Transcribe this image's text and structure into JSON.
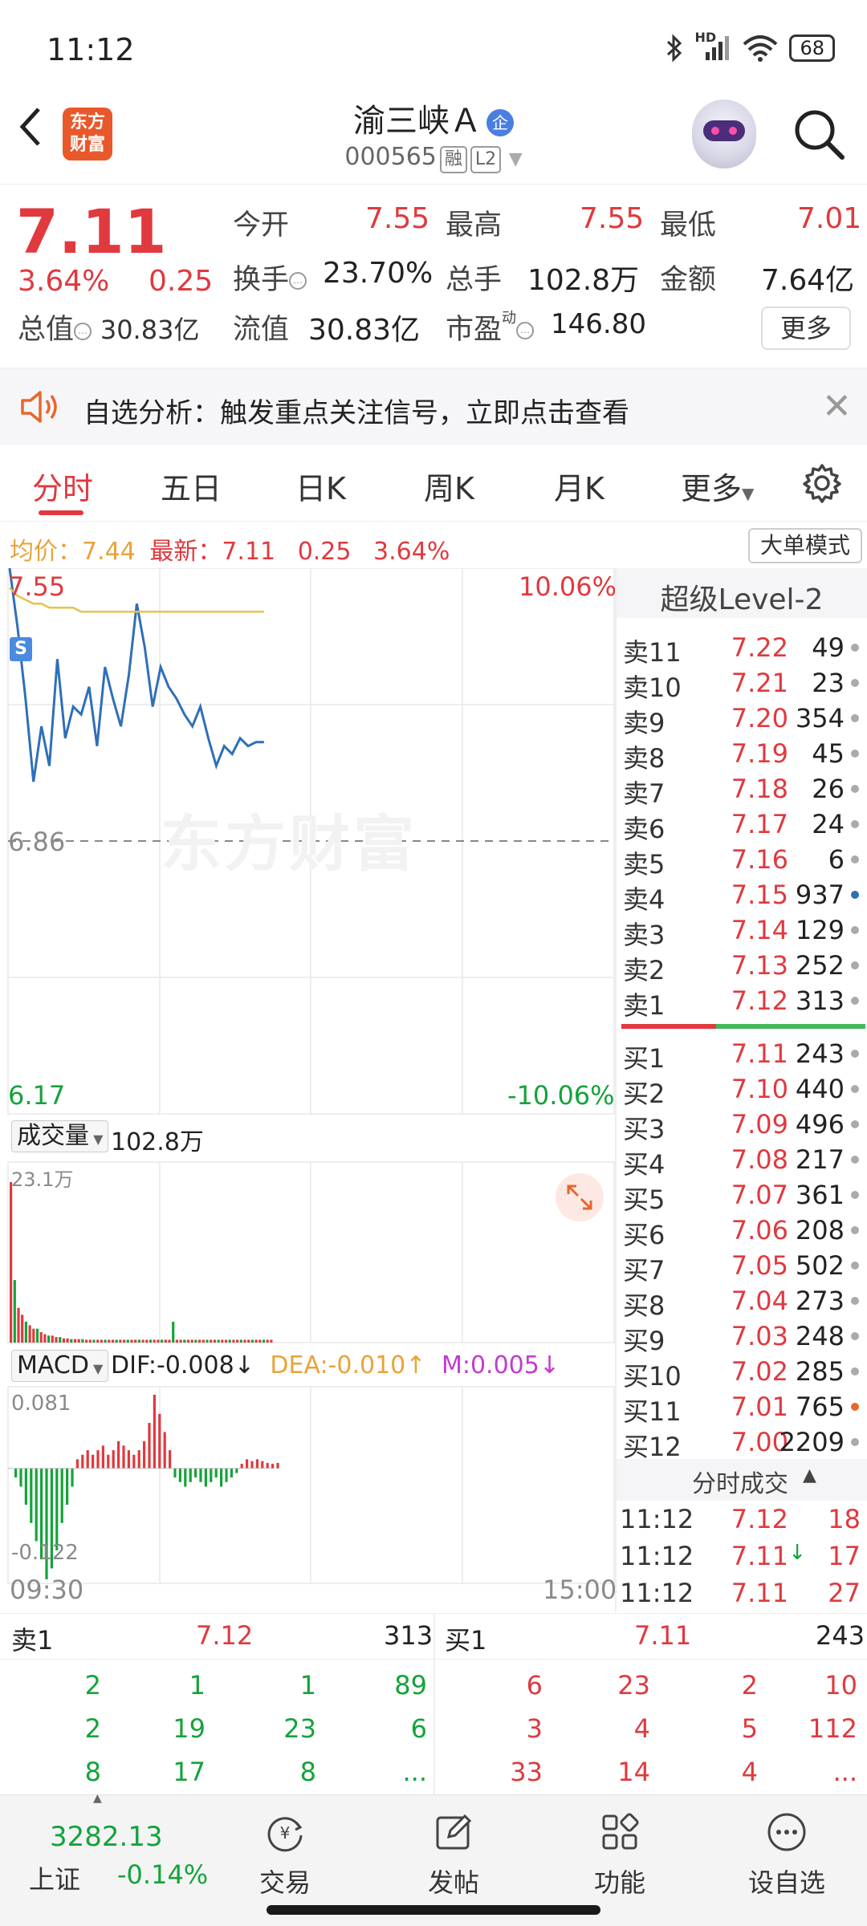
{
  "status_bar": {
    "time": "11:12",
    "hd": "HD",
    "battery": "68"
  },
  "header": {
    "logo_line1": "东方",
    "logo_line2": "财富",
    "stock_name": "渝三峡Ａ",
    "qi_badge": "企",
    "stock_code": "000565",
    "tag_rong": "融",
    "tag_l2": "L2"
  },
  "quote": {
    "last_price": "7.11",
    "change_pct": "3.64%",
    "change_amt": "0.25",
    "open_label": "今开",
    "open": "7.55",
    "high_label": "最高",
    "high": "7.55",
    "low_label": "最低",
    "low": "7.01",
    "turnover_label": "换手",
    "turnover": "23.70%",
    "volume_label": "总手",
    "volume": "102.8万",
    "amount_label": "金额",
    "amount": "7.64亿",
    "total_cap_label": "总值",
    "total_cap": "30.83亿",
    "float_cap_label": "流值",
    "float_cap": "30.83亿",
    "pe_label": "市盈",
    "pe_sup": "动",
    "pe": "146.80",
    "more_label": "更多"
  },
  "notice": {
    "text": "自选分析：触发重点关注信号，立即点击查看"
  },
  "tabs": [
    {
      "label": "分时"
    },
    {
      "label": "五日"
    },
    {
      "label": "日K"
    },
    {
      "label": "周K"
    },
    {
      "label": "月K"
    },
    {
      "label": "更多"
    }
  ],
  "avg_line": {
    "avg_label": "均价：",
    "avg_value": "7.44",
    "latest_label": "最新：",
    "latest": "7.11",
    "chg": "0.25",
    "pct": "3.64%",
    "big_order_label": "大单模式"
  },
  "chart_labels": {
    "top_price": "7.55",
    "top_pct": "10.06%",
    "mid_price": "6.86",
    "bottom_price": "6.17",
    "bottom_pct": "-10.06%",
    "s_marker": "S",
    "watermark": "东方财富",
    "vol_dropdown": "成交量",
    "vol_total": "102.8万",
    "vol_max": "23.1万",
    "macd_dropdown": "MACD",
    "dif": "DIF:-0.008",
    "dif_arrow": "↓",
    "dea": "DEA:-0.010",
    "dea_arrow": "↑",
    "m": "M:0.005",
    "m_arrow": "↓",
    "macd_max": "0.081",
    "macd_min": "-0.122",
    "time_start": "09:30",
    "time_end": "15:00"
  },
  "chart_data": [
    {
      "type": "line",
      "title": "",
      "y_range": [
        6.17,
        7.55
      ],
      "series": [
        {
          "name": "",
          "color": "#2f6fb8",
          "values": [
            7.55,
            7.4,
            7.22,
            7.01,
            7.15,
            7.05,
            7.32,
            7.12,
            7.2,
            7.18,
            7.25,
            7.1,
            7.3,
            7.22,
            7.15,
            7.28,
            7.46,
            7.35,
            7.2,
            7.3,
            7.25,
            7.22,
            7.18,
            7.15,
            7.2,
            7.12,
            7.05,
            7.1,
            7.08,
            7.12,
            7.1,
            7.11,
            7.11
          ]
        },
        {
          "name": "",
          "color": "#e8c24a",
          "values": [
            7.5,
            7.48,
            7.47,
            7.46,
            7.46,
            7.45,
            7.45,
            7.45,
            7.45,
            7.44,
            7.44,
            7.44,
            7.44,
            7.44,
            7.44,
            7.44,
            7.44,
            7.44,
            7.44,
            7.44,
            7.44,
            7.44,
            7.44,
            7.44,
            7.44,
            7.44,
            7.44,
            7.44,
            7.44,
            7.44,
            7.44,
            7.44,
            7.44
          ]
        }
      ]
    },
    {
      "type": "bar",
      "title": "",
      "y_range": [
        0,
        23.1
      ],
      "values": [
        23.1,
        9,
        5,
        4,
        3,
        2.5,
        2,
        2,
        1.5,
        1.2,
        1,
        1,
        0.8,
        0.8,
        0.6,
        0.6,
        0.5,
        0.5,
        0.5,
        0.5,
        0.4,
        0.4,
        0.4,
        0.4,
        0.4,
        0.4,
        0.4,
        0.4,
        0.4,
        0.4,
        0.4,
        0.4,
        0.4,
        0.4,
        0.4,
        0.4,
        0.4,
        0.4,
        0.4,
        0.4,
        0.4,
        0.4,
        0.4,
        3,
        0.4,
        0.4,
        0.4,
        0.4,
        0.4,
        0.4,
        0.4,
        0.4,
        0.4,
        0.4,
        0.4,
        0.4,
        0.4,
        0.4,
        0.4,
        0.4,
        0.4,
        0.4,
        0.4,
        0.4,
        0.4,
        0.4,
        0.4,
        0.4,
        0.4,
        0.4
      ]
    },
    {
      "type": "bar",
      "title": "",
      "y_range": [
        -0.122,
        0.081
      ],
      "values": [
        -0.01,
        -0.02,
        -0.04,
        -0.06,
        -0.08,
        -0.1,
        -0.122,
        -0.11,
        -0.09,
        -0.06,
        -0.04,
        -0.02,
        0.01,
        0.015,
        0.02,
        0.015,
        0.02,
        0.025,
        0.015,
        0.02,
        0.03,
        0.025,
        0.02,
        0.015,
        0.02,
        0.03,
        0.05,
        0.081,
        0.06,
        0.04,
        0.02,
        -0.01,
        -0.015,
        -0.02,
        -0.015,
        -0.01,
        -0.015,
        -0.02,
        -0.015,
        -0.01,
        -0.02,
        -0.015,
        -0.01,
        -0.005,
        0.005,
        0.01,
        0.008,
        0.01,
        0.008,
        0.006,
        0.005,
        0.006
      ]
    }
  ],
  "orderbook": {
    "title": "超级Level-2",
    "asks": [
      {
        "side": "卖11",
        "price": "7.22",
        "vol": "49",
        "dot": "#aaa"
      },
      {
        "side": "卖10",
        "price": "7.21",
        "vol": "23",
        "dot": "#aaa"
      },
      {
        "side": "卖9",
        "price": "7.20",
        "vol": "354",
        "dot": "#aaa"
      },
      {
        "side": "卖8",
        "price": "7.19",
        "vol": "45",
        "dot": "#aaa"
      },
      {
        "side": "卖7",
        "price": "7.18",
        "vol": "26",
        "dot": "#aaa"
      },
      {
        "side": "卖6",
        "price": "7.17",
        "vol": "24",
        "dot": "#aaa"
      },
      {
        "side": "卖5",
        "price": "7.16",
        "vol": "6",
        "dot": "#aaa"
      },
      {
        "side": "卖4",
        "price": "7.15",
        "vol": "937",
        "dot": "#2f6fb8"
      },
      {
        "side": "卖3",
        "price": "7.14",
        "vol": "129",
        "dot": "#aaa"
      },
      {
        "side": "卖2",
        "price": "7.13",
        "vol": "252",
        "dot": "#aaa"
      },
      {
        "side": "卖1",
        "price": "7.12",
        "vol": "313",
        "dot": "#aaa"
      }
    ],
    "bids": [
      {
        "side": "买1",
        "price": "7.11",
        "vol": "243",
        "dot": "#aaa"
      },
      {
        "side": "买2",
        "price": "7.10",
        "vol": "440",
        "dot": "#aaa"
      },
      {
        "side": "买3",
        "price": "7.09",
        "vol": "496",
        "dot": "#aaa"
      },
      {
        "side": "买4",
        "price": "7.08",
        "vol": "217",
        "dot": "#aaa"
      },
      {
        "side": "买5",
        "price": "7.07",
        "vol": "361",
        "dot": "#aaa"
      },
      {
        "side": "买6",
        "price": "7.06",
        "vol": "208",
        "dot": "#aaa"
      },
      {
        "side": "买7",
        "price": "7.05",
        "vol": "502",
        "dot": "#aaa"
      },
      {
        "side": "买8",
        "price": "7.04",
        "vol": "273",
        "dot": "#aaa"
      },
      {
        "side": "买9",
        "price": "7.03",
        "vol": "248",
        "dot": "#aaa"
      },
      {
        "side": "买10",
        "price": "7.02",
        "vol": "285",
        "dot": "#aaa"
      },
      {
        "side": "买11",
        "price": "7.01",
        "vol": "765",
        "dot": "#e8662a"
      },
      {
        "side": "买12",
        "price": "7.00",
        "vol": "2209",
        "dot": "#aaa"
      }
    ],
    "ticks_title": "分时成交",
    "ticks": [
      {
        "time": "11:12",
        "price": "7.12",
        "arrow": "",
        "vol": "18"
      },
      {
        "time": "11:12",
        "price": "7.11",
        "arrow": "↓",
        "vol": "17"
      },
      {
        "time": "11:12",
        "price": "7.11",
        "arrow": "",
        "vol": "27"
      }
    ]
  },
  "depth": {
    "sell_label": "卖1",
    "sell_price": "7.12",
    "sell_vol": "313",
    "buy_label": "买1",
    "buy_price": "7.11",
    "buy_vol": "243",
    "sell_rows": [
      [
        "2",
        "1",
        "1",
        "89"
      ],
      [
        "2",
        "19",
        "23",
        "6"
      ],
      [
        "8",
        "17",
        "8",
        "..."
      ]
    ],
    "buy_rows": [
      [
        "6",
        "23",
        "2",
        "10"
      ],
      [
        "3",
        "4",
        "5",
        "112"
      ],
      [
        "33",
        "14",
        "4",
        "..."
      ]
    ]
  },
  "bottom_nav": {
    "index_value": "3282.13",
    "index_name": "上证",
    "index_change": "-0.14%",
    "items": [
      {
        "label": "交易"
      },
      {
        "label": "发帖"
      },
      {
        "label": "功能"
      },
      {
        "label": "设自选"
      }
    ]
  }
}
